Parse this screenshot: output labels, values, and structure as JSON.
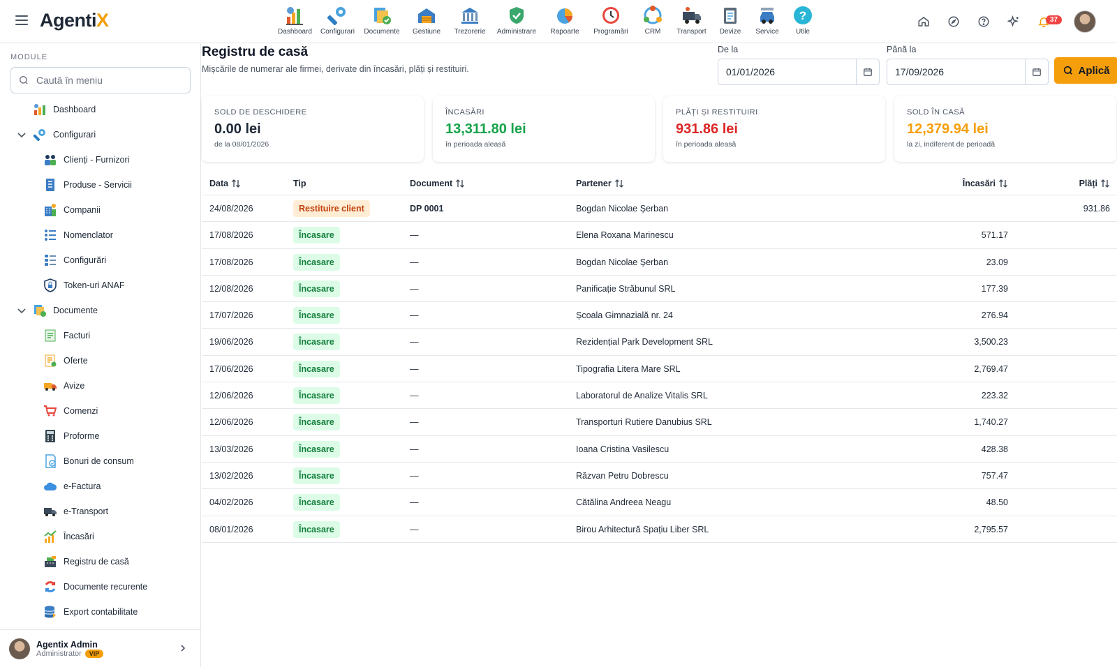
{
  "app": {
    "logo_main": "Agenti",
    "logo_accent": "X"
  },
  "modules": [
    {
      "label": "Dashboard",
      "icon": "dashboard-icon"
    },
    {
      "label": "Configurari",
      "icon": "wrench-icon"
    },
    {
      "label": "Documente",
      "icon": "documents-icon"
    },
    {
      "label": "Gestiune",
      "icon": "warehouse-icon"
    },
    {
      "label": "Trezorerie",
      "icon": "bank-icon"
    },
    {
      "label": "Administrare",
      "icon": "shield-icon"
    },
    {
      "label": "Rapoarte",
      "icon": "pie-chart-icon"
    },
    {
      "label": "Programări",
      "icon": "clock-icon"
    },
    {
      "label": "CRM",
      "icon": "crm-icon"
    },
    {
      "label": "Transport",
      "icon": "truck-icon"
    },
    {
      "label": "Devize",
      "icon": "clipboard-icon"
    },
    {
      "label": "Service",
      "icon": "car-icon"
    },
    {
      "label": "Utile",
      "icon": "help-icon"
    }
  ],
  "header": {
    "notif_count": "37"
  },
  "sidebar": {
    "heading": "MODULE",
    "search_placeholder": "Caută în meniu",
    "items": [
      {
        "label": "Dashboard"
      },
      {
        "label": "Configurari"
      },
      {
        "label": "Clienți - Furnizori"
      },
      {
        "label": "Produse - Servicii"
      },
      {
        "label": "Companii"
      },
      {
        "label": "Nomenclator"
      },
      {
        "label": "Configurări"
      },
      {
        "label": "Token-uri ANAF"
      },
      {
        "label": "Documente"
      },
      {
        "label": "Facturi"
      },
      {
        "label": "Oferte"
      },
      {
        "label": "Avize"
      },
      {
        "label": "Comenzi"
      },
      {
        "label": "Proforme"
      },
      {
        "label": "Bonuri de consum"
      },
      {
        "label": "e-Factura"
      },
      {
        "label": "e-Transport"
      },
      {
        "label": "Încasări"
      },
      {
        "label": "Registru de casă"
      },
      {
        "label": "Documente recurente"
      },
      {
        "label": "Export contabilitate"
      }
    ],
    "user": {
      "name": "Agentix Admin",
      "role": "Administrator",
      "badge": "VIP"
    }
  },
  "page": {
    "title": "Registru de casă",
    "subtitle": "Mișcările de numerar ale firmei, derivate din încasări, plăți și restituiri.",
    "from_label": "De la",
    "from_value": "01/01/2026",
    "to_label": "Până la",
    "to_value": "17/09/2026",
    "apply_label": "Aplică"
  },
  "cards": [
    {
      "label": "SOLD DE DESCHIDERE",
      "value": "0.00 lei",
      "sub": "de la 08/01/2026",
      "color": "#1f2937"
    },
    {
      "label": "ÎNCASĂRI",
      "value": "13,311.80 lei",
      "sub": "în perioada aleasă",
      "color": "#16a34a"
    },
    {
      "label": "PLĂȚI ȘI RESTITUIRI",
      "value": "931.86 lei",
      "sub": "în perioada aleasă",
      "color": "#dc2626"
    },
    {
      "label": "SOLD ÎN CASĂ",
      "value": "12,379.94 lei",
      "sub": "la zi, indiferent de perioadă",
      "color": "#f59e0b"
    }
  ],
  "table": {
    "columns": {
      "date": "Data",
      "type": "Tip",
      "document": "Document",
      "partner": "Partener",
      "income": "Încasări",
      "payments": "Plăți"
    },
    "rows": [
      {
        "date": "24/08/2026",
        "type": "Restituire client",
        "kind": "res",
        "document": "DP 0001",
        "partner": "Bogdan Nicolae Șerban",
        "income": "",
        "payments": "931.86"
      },
      {
        "date": "17/08/2026",
        "type": "Încasare",
        "kind": "inc",
        "document": "—",
        "partner": "Elena Roxana Marinescu",
        "income": "571.17",
        "payments": ""
      },
      {
        "date": "17/08/2026",
        "type": "Încasare",
        "kind": "inc",
        "document": "—",
        "partner": "Bogdan Nicolae Șerban",
        "income": "23.09",
        "payments": ""
      },
      {
        "date": "12/08/2026",
        "type": "Încasare",
        "kind": "inc",
        "document": "—",
        "partner": "Panificație Străbunul SRL",
        "income": "177.39",
        "payments": ""
      },
      {
        "date": "17/07/2026",
        "type": "Încasare",
        "kind": "inc",
        "document": "—",
        "partner": "Școala Gimnazială nr. 24",
        "income": "276.94",
        "payments": ""
      },
      {
        "date": "19/06/2026",
        "type": "Încasare",
        "kind": "inc",
        "document": "—",
        "partner": "Rezidențial Park Development SRL",
        "income": "3,500.23",
        "payments": ""
      },
      {
        "date": "17/06/2026",
        "type": "Încasare",
        "kind": "inc",
        "document": "—",
        "partner": "Tipografia Litera Mare SRL",
        "income": "2,769.47",
        "payments": ""
      },
      {
        "date": "12/06/2026",
        "type": "Încasare",
        "kind": "inc",
        "document": "—",
        "partner": "Laboratorul de Analize Vitalis SRL",
        "income": "223.32",
        "payments": ""
      },
      {
        "date": "12/06/2026",
        "type": "Încasare",
        "kind": "inc",
        "document": "—",
        "partner": "Transporturi Rutiere Danubius SRL",
        "income": "1,740.27",
        "payments": ""
      },
      {
        "date": "13/03/2026",
        "type": "Încasare",
        "kind": "inc",
        "document": "—",
        "partner": "Ioana Cristina Vasilescu",
        "income": "428.38",
        "payments": ""
      },
      {
        "date": "13/02/2026",
        "type": "Încasare",
        "kind": "inc",
        "document": "—",
        "partner": "Răzvan Petru Dobrescu",
        "income": "757.47",
        "payments": ""
      },
      {
        "date": "04/02/2026",
        "type": "Încasare",
        "kind": "inc",
        "document": "—",
        "partner": "Cătălina Andreea Neagu",
        "income": "48.50",
        "payments": ""
      },
      {
        "date": "08/01/2026",
        "type": "Încasare",
        "kind": "inc",
        "document": "—",
        "partner": "Birou Arhitectură Spațiu Liber SRL",
        "income": "2,795.57",
        "payments": ""
      }
    ]
  }
}
